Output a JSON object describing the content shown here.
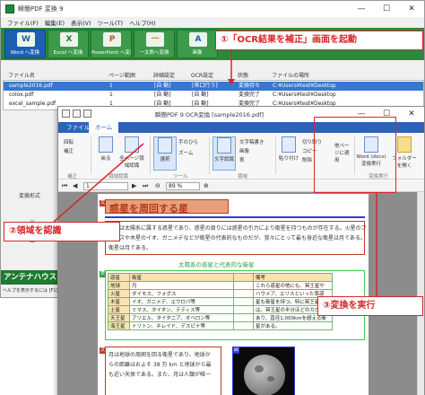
{
  "back_window": {
    "title": "瞬簡PDF 変換 9",
    "menu": [
      "ファイル(F)",
      "編集(E)",
      "表示(V)",
      "ツール(T)",
      "ヘルプ(H)"
    ],
    "toolbar": [
      {
        "label": "Word へ変換",
        "icon": "word-icon",
        "glyph": "W"
      },
      {
        "label": "Excel へ変換",
        "icon": "excel-icon",
        "glyph": "X"
      },
      {
        "label": "PowerPoint へ変換",
        "icon": "powerpoint-icon",
        "glyph": "P"
      },
      {
        "label": "一太郎へ変換",
        "icon": "ichitaro-icon",
        "glyph": "一"
      },
      {
        "label": "画像",
        "icon": "image-icon",
        "glyph": "A"
      }
    ],
    "columns": [
      "ファイル名",
      "ページ範囲",
      "詳細設定",
      "OCR設定",
      "状態",
      "ファイルの場所"
    ],
    "files": [
      {
        "name": "sample2016.pdf",
        "range": "1",
        "detail": "[自 動]",
        "ocr": "[帯口行う]",
        "status": "変換待ち",
        "path": "C:¥Users¥test¥Desktop"
      },
      {
        "name": "colox.pdf",
        "range": "1",
        "detail": "[自 動]",
        "ocr": "[自 動]",
        "status": "変換完了",
        "path": "C:¥Users¥test¥Desktop"
      },
      {
        "name": "excel_sample.pdf",
        "range": "1",
        "detail": "[自 動]",
        "ocr": "[自 動]",
        "status": "変換完了",
        "path": "C:¥Users¥test¥Desktop"
      }
    ],
    "lower": {
      "label": "変換形式",
      "output1": "出",
      "output2": "出"
    },
    "brand": "アンテナハウス",
    "status": "ヘルプを表示するには [F1]"
  },
  "front_window": {
    "title": "瞬簡PDF 9 OCR変換 [sample2016.pdf]",
    "tabs": [
      "ファイル",
      "ホーム"
    ],
    "ribbon": {
      "rotate": "回転",
      "fix": "補正",
      "undo": "戻る",
      "all_recognize": "全ページ領域認識",
      "region_group": "領域認識",
      "select": "選択",
      "hand": "手のひら",
      "zoom": "ズーム",
      "tool_group": "ツール",
      "char_recog": "文字認識",
      "text_edit": "文字稿書き",
      "image": "画像",
      "table": "表",
      "region_edit": "領域",
      "paste": "貼り付け",
      "cut": "切り取り",
      "copy": "コピー",
      "delete": "削除",
      "other_page": "他ページに適用",
      "word_convert": "Word (docx) 変換実行",
      "folder_open": "フォルダーを開く",
      "convert_group": "変換実行"
    },
    "nav": {
      "page": "1",
      "zoom": "89 %"
    },
    "document": {
      "heading": "惑星を周回する星",
      "para1": [
        "惑星は太陽系に属する惑星であり、惑星の周りには惑星の引力により衛星を持つものが存在する。火星のフ",
        "イモスや木星のイオ、ガニメデなどが衛星の代表的なものだが、我々にとって最も身近な衛星は月である。",
        "衛星は月である。"
      ],
      "table_title": "太陽系の惑星と代表的な衛星",
      "table": {
        "headers": [
          "惑星",
          "衛星",
          "備考"
        ],
        "rows": [
          [
            "地球",
            "月",
            "これら惑星の他にも、冥王星や"
          ],
          [
            "火星",
            "ダイモス、フォボス",
            "ハウメア、エリスといった準惑"
          ],
          [
            "木星",
            "イオ、ガニメデ、エウロパ等",
            "星も衛星を持つ。特に冥王星に"
          ],
          [
            "土星",
            "ミマス、タイタン、テティス等",
            "は、冥王星の半分ほどのカロンが"
          ],
          [
            "天王星",
            "アリエル、タイタニア、オベロン等",
            "あり、直径1,000kmを超える衛"
          ],
          [
            "海王星",
            "トリトン、ネレイド、デスピナ等",
            "星がある。"
          ]
        ]
      },
      "para2": [
        "月は地球の周囲を回る衛星であり、地球か",
        "らの距離はおよそ 38 万 km と地球から最",
        "も近い天体である。また、月は人類が唯一"
      ]
    }
  },
  "callouts": {
    "c1": "①「OCR結果を補正」画面を起動",
    "c2": "②領域を認識",
    "c3": "③変換を実行"
  },
  "colors": {
    "accent": "#d9262b",
    "toolbar_green": "#2a8a3b",
    "tab_blue": "#2b64b7"
  }
}
